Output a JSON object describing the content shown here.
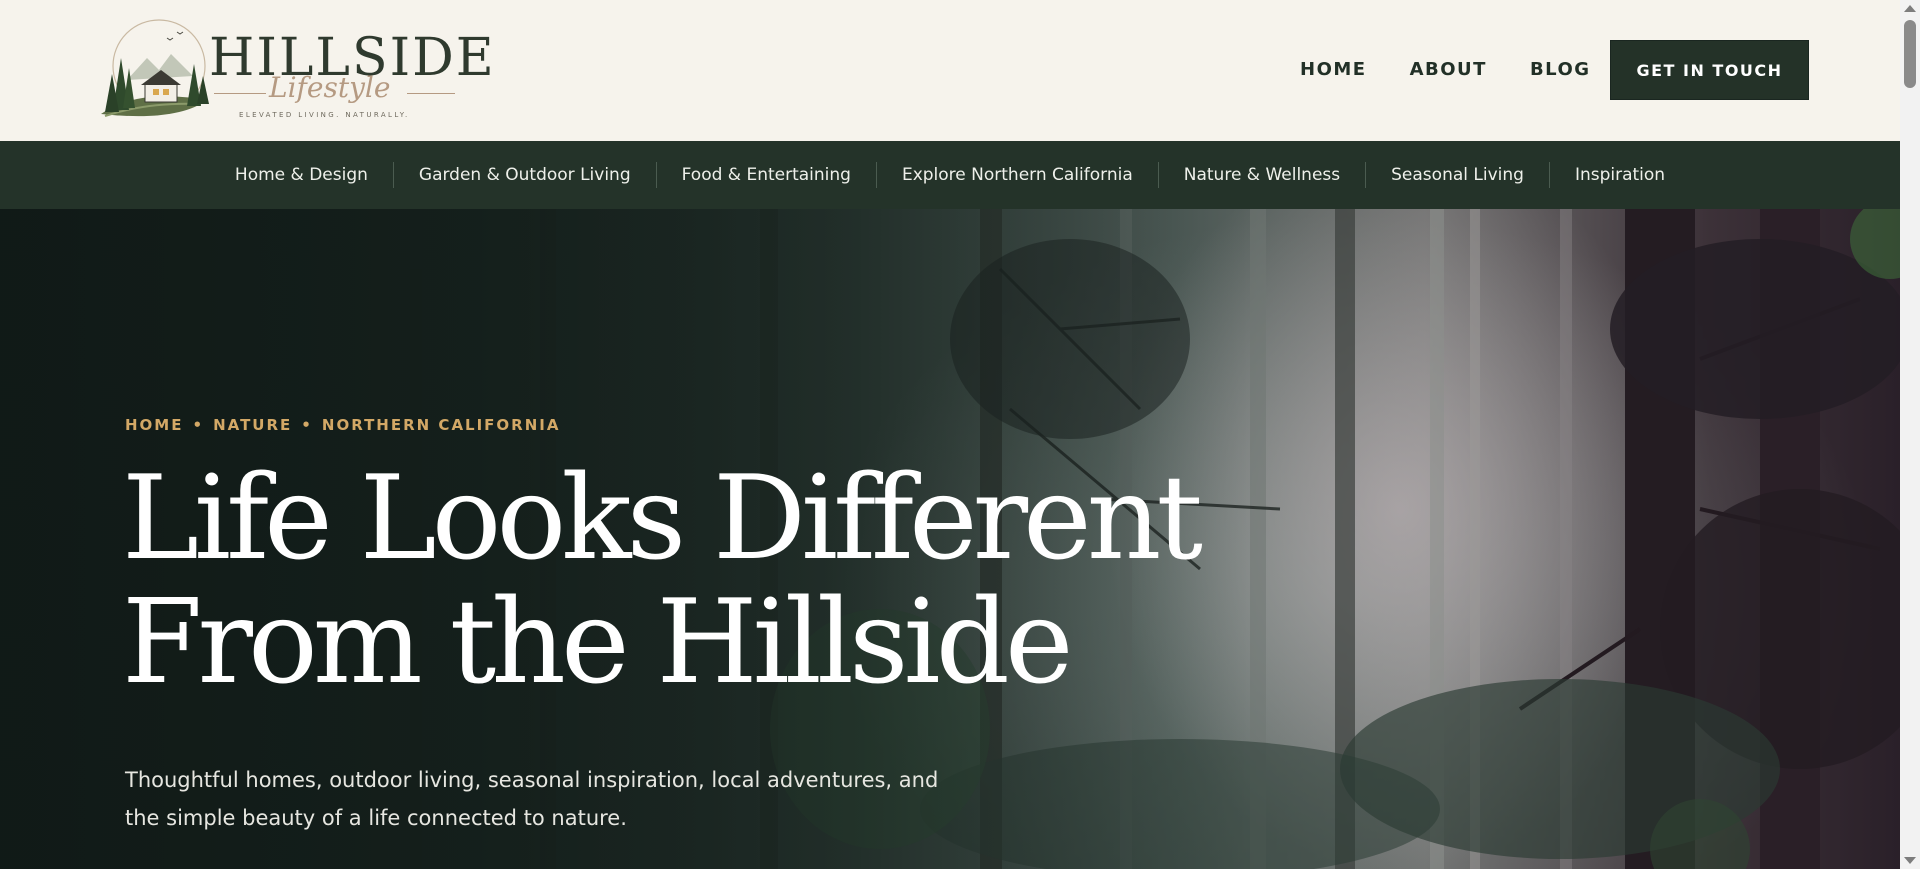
{
  "header": {
    "logo": {
      "name": "HILLSIDE",
      "script": "Lifestyle",
      "tagline": "ELEVATED LIVING. NATURALLY.",
      "icon": "pine-forest-cabin-icon"
    },
    "nav": [
      {
        "label": "HOME"
      },
      {
        "label": "ABOUT"
      },
      {
        "label": "BLOG"
      }
    ],
    "cta_label": "GET IN TOUCH"
  },
  "categories": [
    {
      "label": "Home & Design"
    },
    {
      "label": "Garden & Outdoor Living"
    },
    {
      "label": "Food & Entertaining"
    },
    {
      "label": "Explore Northern California"
    },
    {
      "label": "Nature & Wellness"
    },
    {
      "label": "Seasonal Living"
    },
    {
      "label": "Inspiration"
    }
  ],
  "hero": {
    "breadcrumb": [
      "HOME",
      "NATURE",
      "NORTHERN CALIFORNIA"
    ],
    "breadcrumb_separator": "•",
    "title_line1": "Life Looks Different",
    "title_line2": "From the Hillside",
    "subtitle": "Thoughtful homes, outdoor living, seasonal inspiration, local adventures, and the simple beauty of a life connected to nature.",
    "background": "misty-forest-photo"
  },
  "colors": {
    "cream": "#f6f3ec",
    "forest_green": "#243329",
    "gold_accent": "#d3a866",
    "script_rose": "#b59a82"
  }
}
